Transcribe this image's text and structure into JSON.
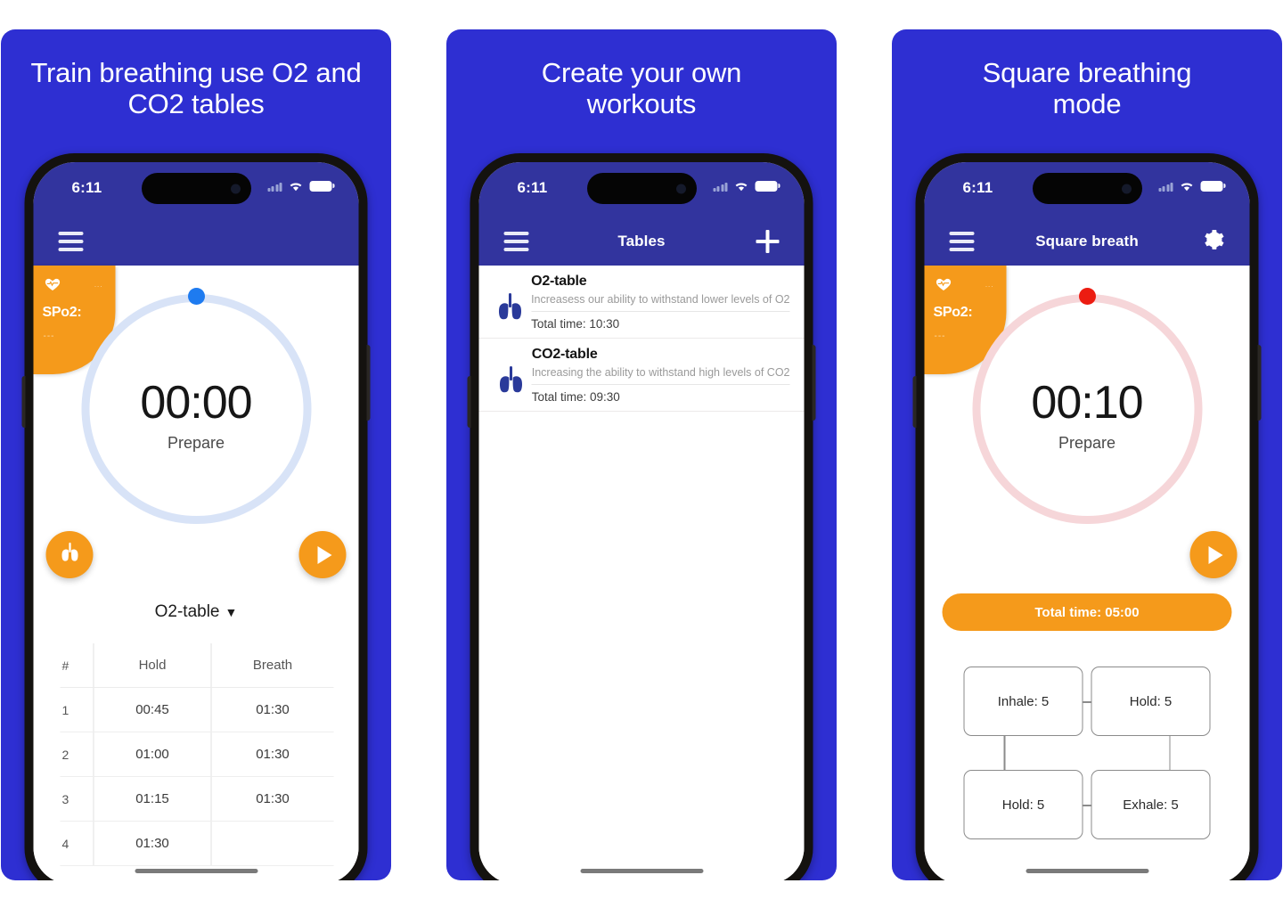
{
  "theme": {
    "card_bg": "#2E2FD2",
    "app_bar": "#32349E",
    "accent_orange": "#F59A1B",
    "ring_blue": "#D8E3F7",
    "ring_pink": "#F6D6D9",
    "dot_blue": "#1E7BF0",
    "dot_red": "#EC1C11",
    "lungs_blue": "#2A3A9A"
  },
  "cards": [
    {
      "headline": "Train breathing use O2 and\nCO2 tables",
      "status": {
        "time": "6:11",
        "wifi_icon": "wifi-icon",
        "battery_icon": "battery-icon",
        "signal_icon": "signal-icon"
      },
      "appbar": {
        "menu_icon": "hamburger-menu-icon",
        "title": "",
        "action_icon": ""
      },
      "spo2": {
        "label": "SPo2:",
        "heart_icon": "heart-icon",
        "corner_value": "...",
        "value": "---"
      },
      "timer": {
        "value": "00:00",
        "label": "Prepare"
      },
      "buttons": {
        "left_icon": "lungs-icon",
        "right_icon": "play-icon"
      },
      "table_select": {
        "label": "O2-table",
        "caret": "▼"
      },
      "table": {
        "headers": [
          "#",
          "Hold",
          "Breath"
        ],
        "rows": [
          [
            "1",
            "00:45",
            "01:30"
          ],
          [
            "2",
            "01:00",
            "01:30"
          ],
          [
            "3",
            "01:15",
            "01:30"
          ],
          [
            "4",
            "01:30",
            ""
          ]
        ]
      }
    },
    {
      "headline": "Create your own\nworkouts",
      "status": {
        "time": "6:11",
        "wifi_icon": "wifi-icon",
        "battery_icon": "battery-icon",
        "signal_icon": "signal-icon"
      },
      "appbar": {
        "menu_icon": "hamburger-menu-icon",
        "title": "Tables",
        "action_icon": "plus-icon"
      },
      "list": [
        {
          "icon": "lungs-icon",
          "title": "O2-table",
          "description": "Increasess our ability to withstand lower levels of O2",
          "total_time": "Total time: 10:30"
        },
        {
          "icon": "lungs-icon",
          "title": "CO2-table",
          "description": "Increasing the ability to withstand high levels of CO2",
          "total_time": "Total time: 09:30"
        }
      ]
    },
    {
      "headline": "Square breathing\nmode",
      "status": {
        "time": "6:11",
        "wifi_icon": "wifi-icon",
        "battery_icon": "battery-icon",
        "signal_icon": "signal-icon"
      },
      "appbar": {
        "menu_icon": "hamburger-menu-icon",
        "title": "Square breath",
        "action_icon": "gear-icon"
      },
      "spo2": {
        "label": "SPo2:",
        "heart_icon": "heart-icon",
        "corner_value": "...",
        "value": "---"
      },
      "timer": {
        "value": "00:10",
        "label": "Prepare"
      },
      "buttons": {
        "right_icon": "play-icon"
      },
      "total_pill": "Total time: 05:00",
      "square": {
        "top_left": "Inhale: 5",
        "top_right": "Hold: 5",
        "bottom_left": "Hold: 5",
        "bottom_right": "Exhale: 5"
      }
    }
  ]
}
